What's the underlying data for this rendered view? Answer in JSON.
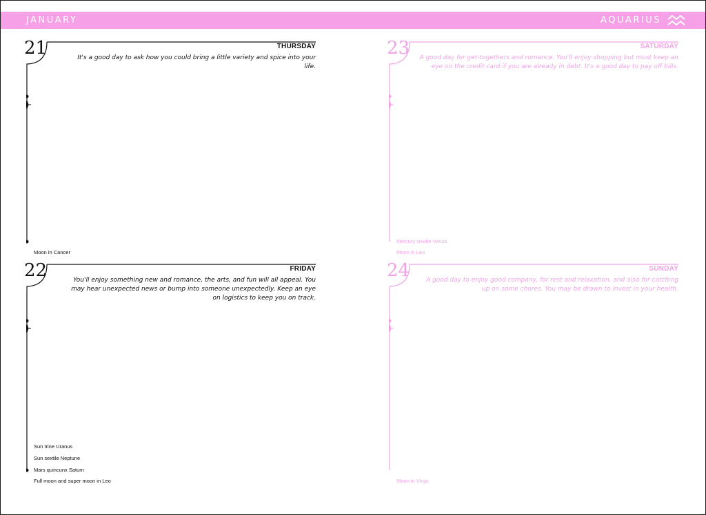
{
  "header": {
    "month": "JANUARY",
    "sign": "AQUARIUS",
    "sign_icon": "aquarius-icon"
  },
  "colors": {
    "accent": "#f6a0e8",
    "text": "#111111",
    "weekend_text": "#f2a3e6"
  },
  "days": [
    {
      "number": "21",
      "weekday": "THURSDAY",
      "message": "It's a good day to ask how you could bring a little variety and spice into your life.",
      "events": [],
      "moon": "Moon in Cancer"
    },
    {
      "number": "22",
      "weekday": "FRIDAY",
      "message": "You'll enjoy something new and romance, the arts, and fun will all appeal. You may hear unexpected news or bump into someone unexpectedly. Keep an eye on logistics to keep you on track.",
      "events": [
        "Sun trine Uranus",
        "Sun sextile Neptune",
        "Mars quincunx Saturn"
      ],
      "moon": "Full moon and super moon in Leo"
    },
    {
      "number": "23",
      "weekday": "SATURDAY",
      "message": "A good day for get-togethers and romance. You'll enjoy shopping but must keep an eye on the credit card if you are already in debt. It's a good day to pay off bills.",
      "events": [
        "Mercury sextile Venus"
      ],
      "moon": "Moon in Leo"
    },
    {
      "number": "24",
      "weekday": "SUNDAY",
      "message": "A good day to enjoy good company, for rest and relaxation, and also for catching up on some chores. You may be drawn to invest in your health.",
      "events": [],
      "moon": "Moon in Virgo"
    }
  ]
}
